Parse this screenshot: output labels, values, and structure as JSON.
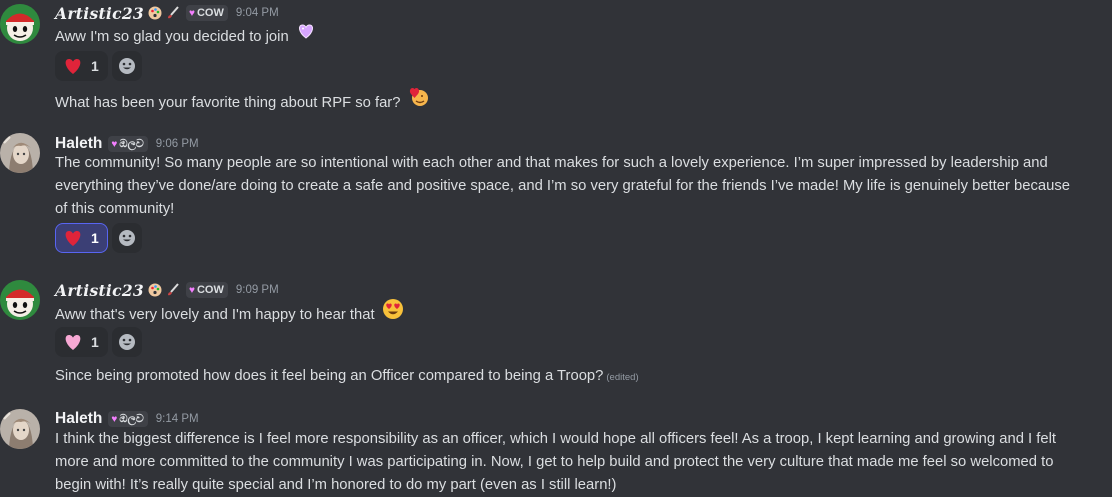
{
  "messages": [
    {
      "author": "Artistic23",
      "tag": "COW",
      "time": "9:04 PM",
      "lines": [
        "Aww I'm so glad you decided to join"
      ],
      "reaction_count": "1",
      "followup": "What has been your favorite thing about RPF so far?"
    },
    {
      "author": "Haleth",
      "tag": "ඔලව",
      "time": "9:06 PM",
      "lines": [
        "The community! So many people are so intentional with each other and that makes for such a lovely experience. I’m super impressed by leadership and",
        "everything they’ve done/are doing to create a safe and positive space, and I’m so very grateful for the friends I’ve made! My life is genuinely better because",
        "of this community!"
      ],
      "reaction_count": "1"
    },
    {
      "author": "Artistic23",
      "tag": "COW",
      "time": "9:09 PM",
      "lines": [
        "Aww that's very lovely and I'm happy to hear that"
      ],
      "reaction_count": "1",
      "followup": "Since being promoted how does it feel being an Officer compared to being a Troop?",
      "edited": "(edited)"
    },
    {
      "author": "Haleth",
      "tag": "ඔලව",
      "time": "9:14 PM",
      "lines": [
        "I think the biggest difference is I feel more responsibility as an officer, which I would hope all officers feel! As a troop, I kept learning and growing and I felt",
        "more and more committed to the community I was participating in. Now, I get to help build and protect the very culture that made me feel so welcomed to",
        "begin with! It’s really quite special and I’m honored to do my part (even as I still learn!)"
      ]
    }
  ],
  "colors": {
    "background": "#313338",
    "text": "#dbdee1",
    "muted": "#949ba4",
    "reaction_bg": "#2b2d31",
    "reaction_active_bg": "#3b3f75",
    "reaction_active_border": "#5865f2"
  },
  "icons": [
    "heart-emoji",
    "sparkle-heart-emoji",
    "heart-eyes-emoji",
    "pink-heart-emoji",
    "add-reaction-icon",
    "palette-icon",
    "paintbrush-icon"
  ]
}
